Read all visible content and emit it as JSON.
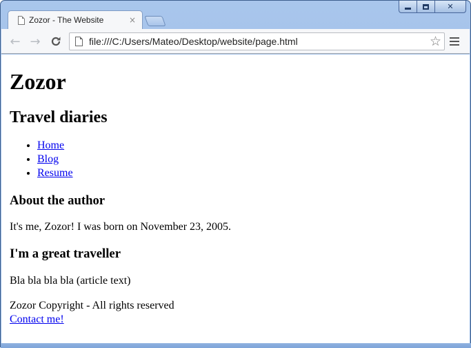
{
  "window": {
    "caption_buttons": {
      "minimize_icon": "minimize-icon",
      "maximize_icon": "maximize-icon",
      "close_glyph": "✕"
    },
    "accent_color": "#a9c6ec"
  },
  "tab": {
    "title": "Zozor - The Website",
    "close_glyph": "×"
  },
  "toolbar": {
    "back_glyph": "←",
    "forward_glyph": "→",
    "reload_glyph": "C",
    "url": "file:///C:/Users/Mateo/Desktop/website/page.html",
    "star_glyph": "☆"
  },
  "page": {
    "title": "Zozor",
    "subtitle": "Travel diaries",
    "nav": [
      {
        "label": "Home"
      },
      {
        "label": "Blog"
      },
      {
        "label": "Resume"
      }
    ],
    "about_heading": "About the author",
    "about_text": "It's me, Zozor! I was born on November 23, 2005.",
    "article_heading": "I'm a great traveller",
    "article_text": "Bla bla bla bla (article text)",
    "footer_text": "Zozor Copyright - All rights reserved",
    "contact_link": "Contact me!",
    "link_color": "#0000ee"
  }
}
